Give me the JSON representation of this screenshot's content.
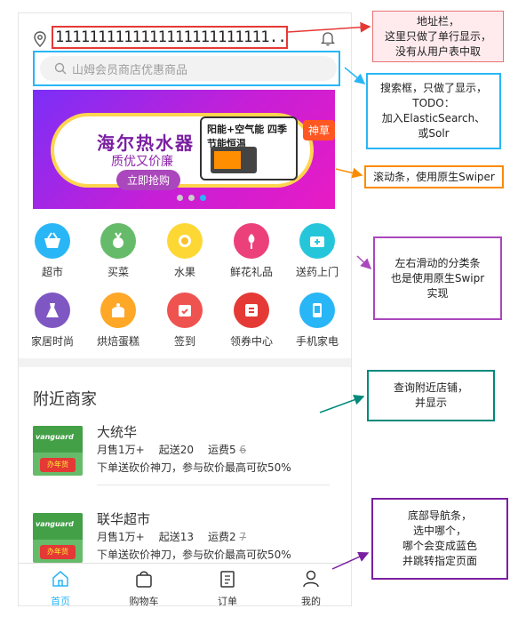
{
  "address": {
    "text": "1111111111111111111111111..."
  },
  "search": {
    "placeholder": "山姆会员商店优惠商品"
  },
  "banner": {
    "title": "海尔热水器",
    "subtitle": "质优又价廉",
    "button": "立即抢购",
    "product_title": "阳能+空气能 四季节能恒温",
    "badge": "神草"
  },
  "categories": [
    {
      "label": "超市",
      "icon": "basket-icon",
      "color": "#29b6f6"
    },
    {
      "label": "买菜",
      "icon": "vegetable-icon",
      "color": "#66bb6a"
    },
    {
      "label": "水果",
      "icon": "lemon-icon",
      "color": "#fdd835"
    },
    {
      "label": "鲜花礼品",
      "icon": "flower-icon",
      "color": "#ec407a"
    },
    {
      "label": "送药上门",
      "icon": "medicine-icon",
      "color": "#26c6da"
    },
    {
      "label": "家居时尚",
      "icon": "dress-icon",
      "color": "#7e57c2"
    },
    {
      "label": "烘焙蛋糕",
      "icon": "cake-icon",
      "color": "#ffa726"
    },
    {
      "label": "签到",
      "icon": "calendar-icon",
      "color": "#ef5350"
    },
    {
      "label": "领券中心",
      "icon": "coupon-icon",
      "color": "#e53935"
    },
    {
      "label": "手机家电",
      "icon": "phone-icon",
      "color": "#29b6f6"
    }
  ],
  "nearby": {
    "title": "附近商家",
    "shops": [
      {
        "name": "大统华",
        "sales": "月售1万+",
        "min_order": "起送20",
        "delivery": "运费5",
        "delivery_old": "6",
        "promo": "下单送砍价神刀，参与砍价最高可砍50%",
        "thumb_text": "vanguard",
        "thumb_badge": "办年货"
      },
      {
        "name": "联华超市",
        "sales": "月售1万+",
        "min_order": "起送13",
        "delivery": "运费2",
        "delivery_old": "7",
        "promo": "下单送砍价神刀，参与砍价最高可砍50%",
        "thumb_text": "vanguard",
        "thumb_badge": "办年货"
      }
    ]
  },
  "tabbar": [
    {
      "label": "首页",
      "icon": "home-icon",
      "active": true
    },
    {
      "label": "购物车",
      "icon": "cart-icon",
      "active": false
    },
    {
      "label": "订单",
      "icon": "order-icon",
      "active": false
    },
    {
      "label": "我的",
      "icon": "user-icon",
      "active": false
    }
  ],
  "annotations": {
    "address": "地址栏，\n这里只做了单行显示，\n没有从用户表中取",
    "search": "搜索框，只做了显示，\nTODO：\n加入ElasticSearch、\n或Solr",
    "swiper": "滚动条，使用原生Swiper",
    "category": "左右滑动的分类条\n也是使用原生Swipr\n实现",
    "shops": "查询附近店铺，\n并显示",
    "tabbar": "底部导航条，\n选中哪个，\n哪个会变成蓝色\n并跳转指定页面"
  },
  "colors": {
    "accent": "#29b6f6",
    "address_border": "#e53935"
  }
}
